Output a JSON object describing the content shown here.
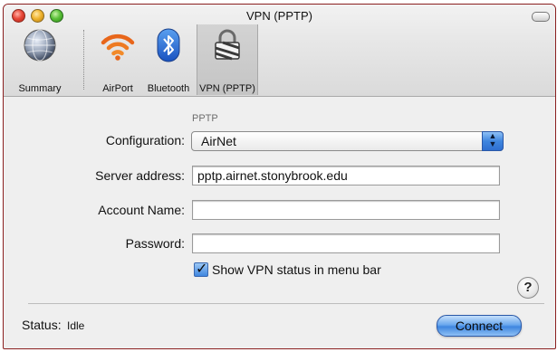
{
  "window": {
    "title": "VPN (PPTP)"
  },
  "toolbar": {
    "items": [
      {
        "label": "Summary",
        "icon": "globe-icon"
      },
      {
        "label": "AirPort",
        "icon": "airport-wifi-icon"
      },
      {
        "label": "Bluetooth",
        "icon": "bluetooth-icon"
      },
      {
        "label": "VPN (PPTP)",
        "icon": "vpn-lock-icon",
        "selected": true
      }
    ]
  },
  "form": {
    "section_label": "PPTP",
    "configuration": {
      "label": "Configuration:",
      "value": "AirNet"
    },
    "server_address": {
      "label": "Server address:",
      "value": "pptp.airnet.stonybrook.edu"
    },
    "account_name": {
      "label": "Account Name:",
      "value": ""
    },
    "password": {
      "label": "Password:",
      "value": ""
    },
    "show_status": {
      "label": "Show VPN status in menu bar",
      "checked": true
    }
  },
  "footer": {
    "status_label": "Status:",
    "status_value": "Idle",
    "connect_label": "Connect"
  },
  "colors": {
    "accent": "#3f86df",
    "window_border": "#8a1f1f"
  }
}
